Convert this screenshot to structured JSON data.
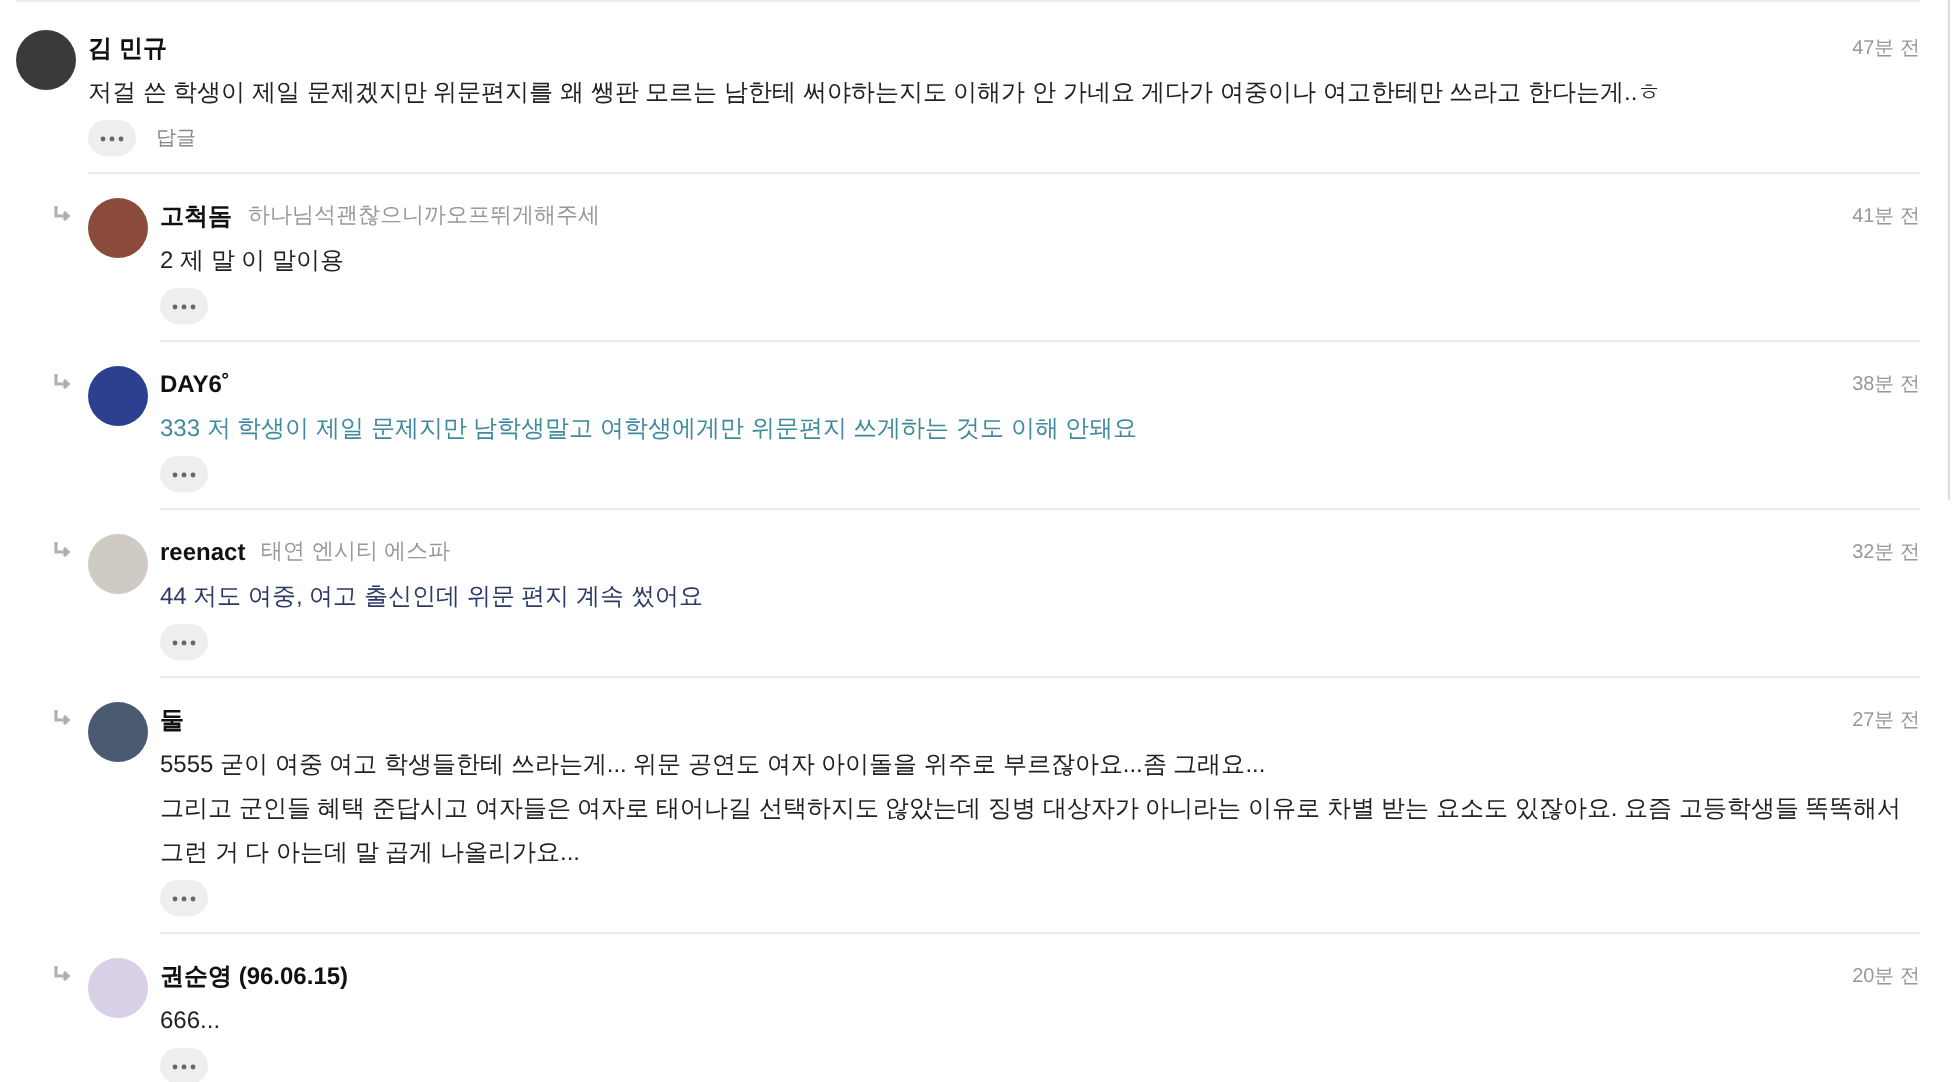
{
  "comments": [
    {
      "kind": "top",
      "author": "김 민규",
      "lines": [
        "저걸 쓴 학생이 제일 문제겠지만 위문편지를 왜 쌩판 모르는 남한테 써야하는지도 이해가 안 가네요 게다가 여중이나 여고한테만 쓰라고 한다는게..ㅎ"
      ],
      "time": "47분 전",
      "reply_label": "답글",
      "color": "#222222"
    },
    {
      "kind": "reply",
      "author": "고척돔",
      "tagline": "하나님석괜찮으니까오프뛰게해주세",
      "lines": [
        "2 제 말 이 말이용"
      ],
      "time": "41분 전",
      "color": "#222222"
    },
    {
      "kind": "reply",
      "author": "DAY6˚",
      "lines": [
        "333 저 학생이 제일 문제지만 남학생말고 여학생에게만 위문편지 쓰게하는 것도 이해 안돼요"
      ],
      "time": "38분 전",
      "color": "#3f8a9c"
    },
    {
      "kind": "reply",
      "author": "reenact",
      "tagline": "태연 엔시티 에스파",
      "lines": [
        "44 저도 여중, 여고 출신인데 위문 편지 계속 썼어요"
      ],
      "time": "32분 전",
      "color": "#2c3a66"
    },
    {
      "kind": "reply",
      "author": "둘",
      "lines": [
        "5555 굳이 여중 여고 학생들한테 쓰라는게... 위문 공연도 여자 아이돌을 위주로 부르잖아요...좀 그래요...",
        "그리고 군인들 혜택 준답시고 여자들은 여자로 태어나길 선택하지도 않았는데 징병 대상자가 아니라는 이유로 차별 받는 요소도 있잖아요. 요즘 고등학생들 똑똑해서",
        "그런 거 다 아는데 말 곱게 나올리가요..."
      ],
      "time": "27분 전",
      "color": "#222222"
    },
    {
      "kind": "reply",
      "author": "권순영 (96.06.15)",
      "lines": [
        "666..."
      ],
      "time": "20분 전",
      "color": "#222222"
    }
  ]
}
